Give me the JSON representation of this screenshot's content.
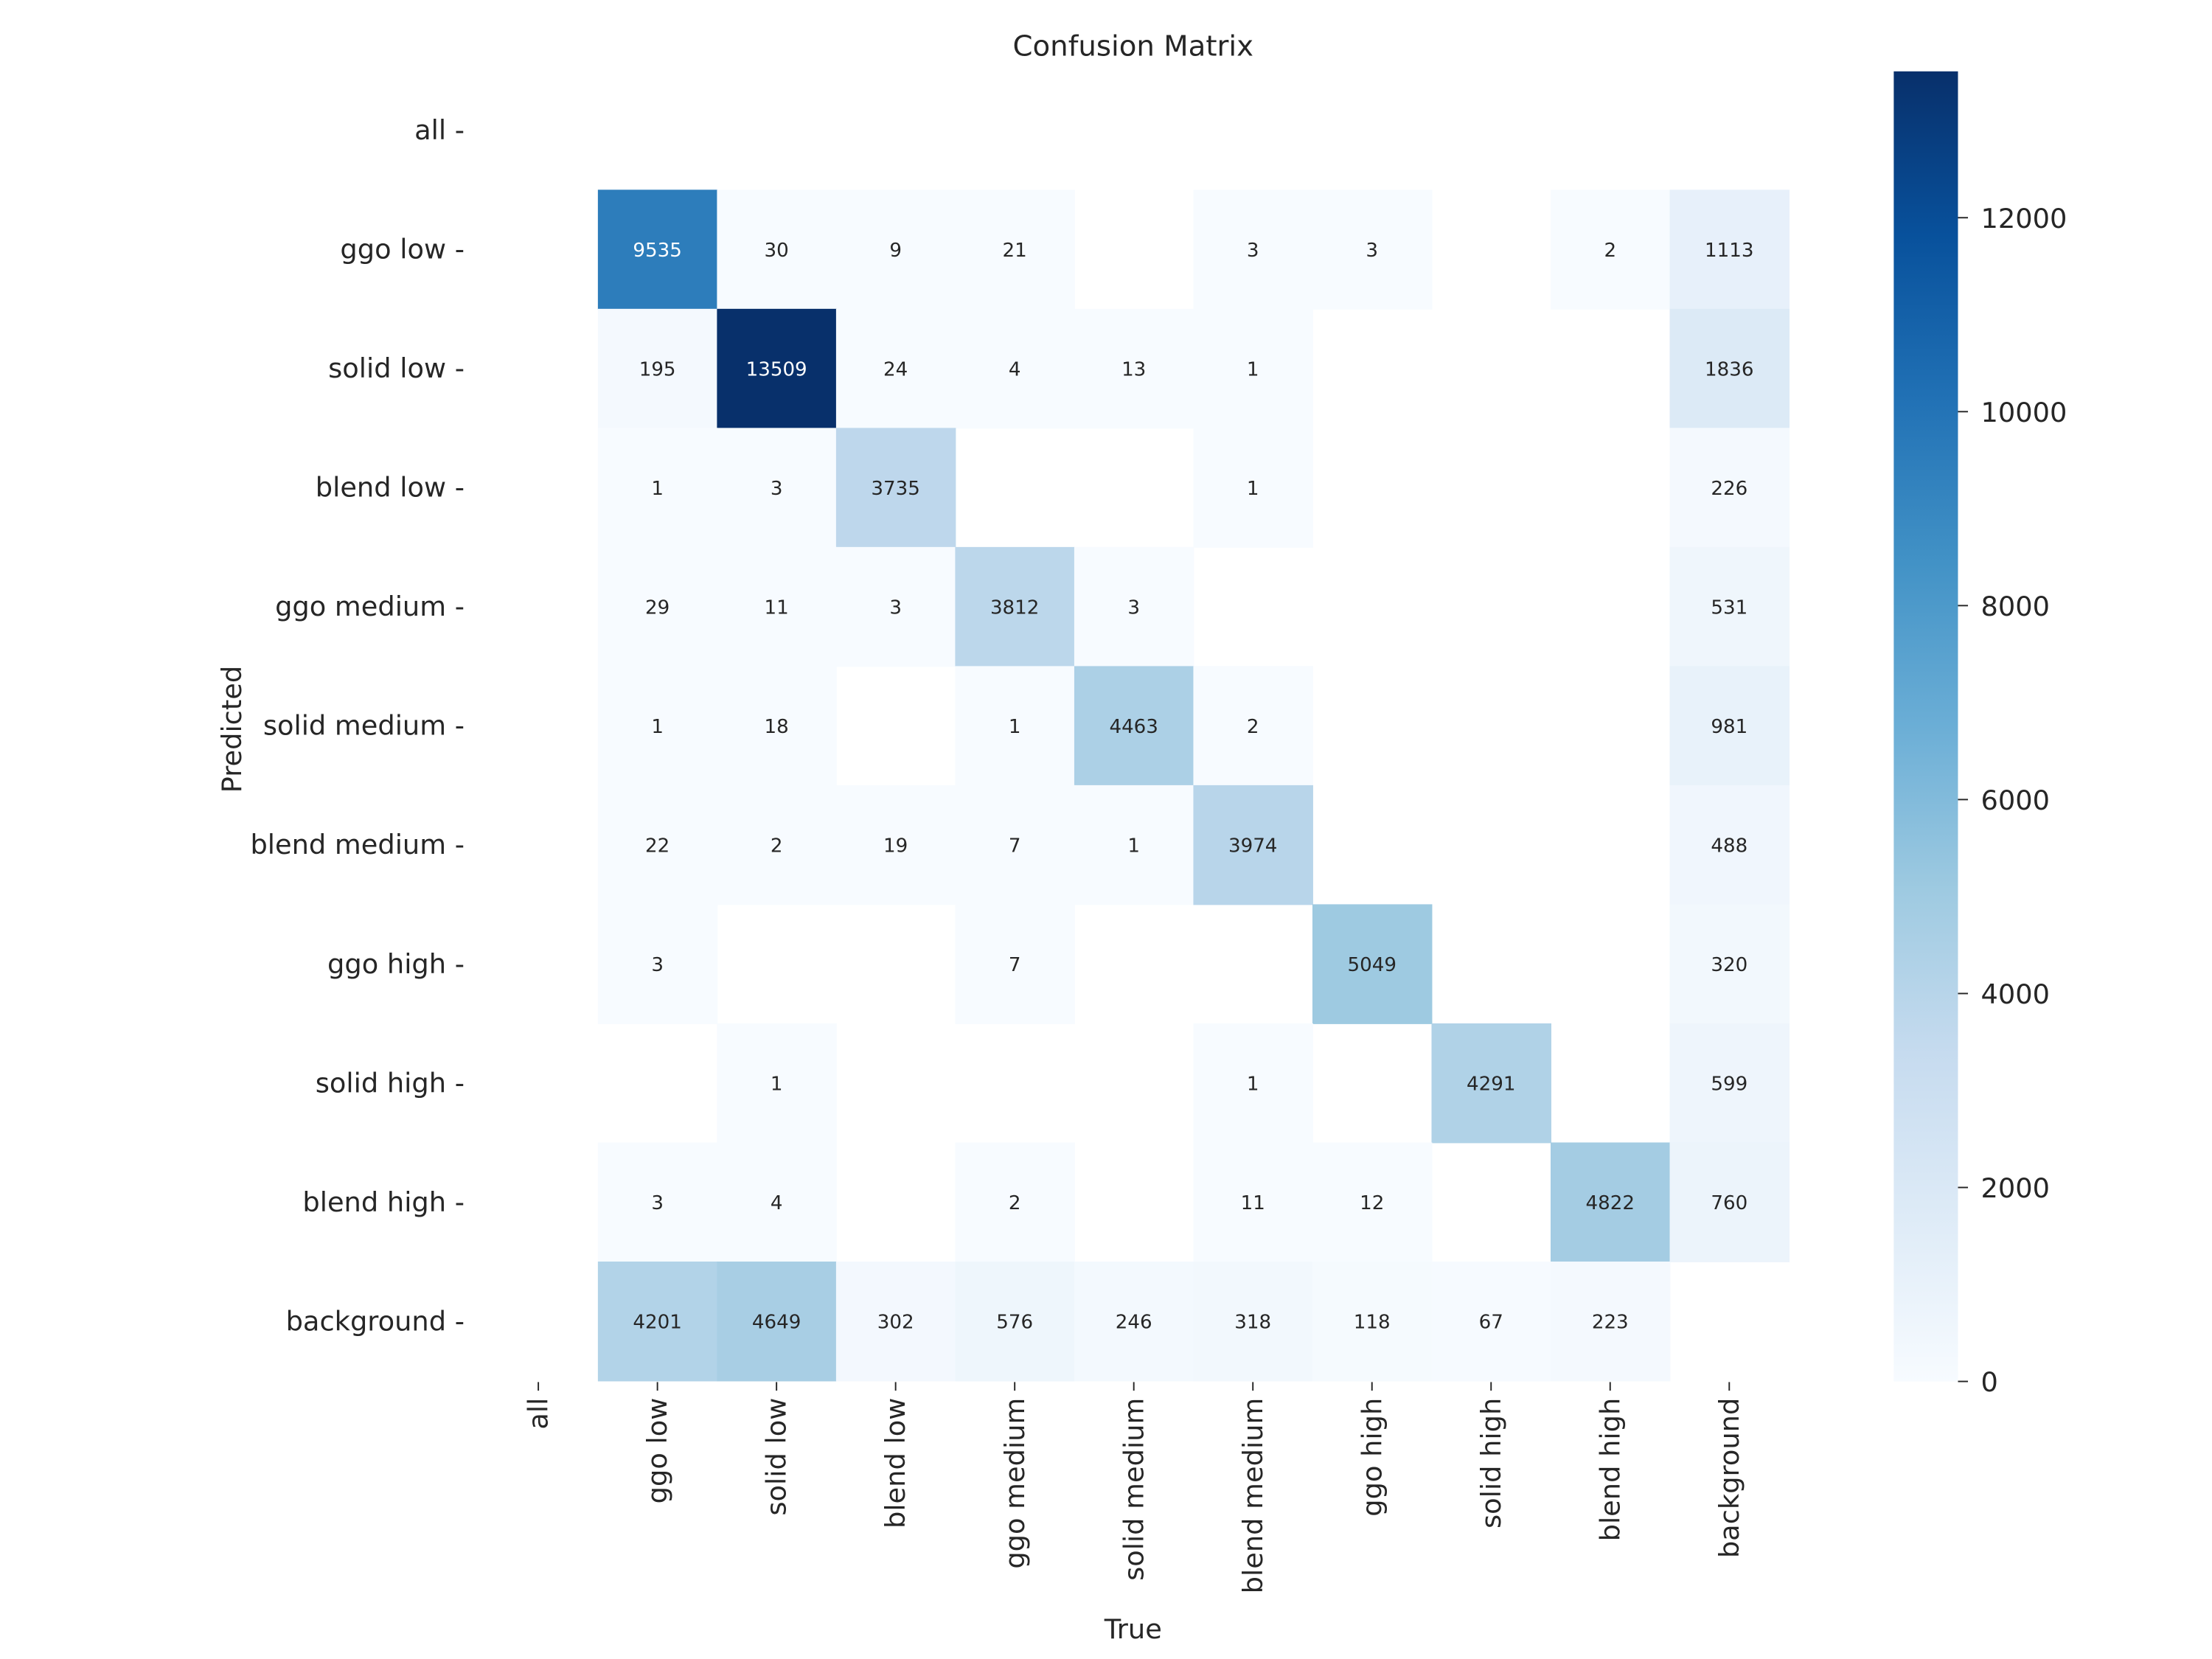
{
  "chart_data": {
    "type": "heatmap",
    "title": "Confusion Matrix",
    "xlabel": "True",
    "ylabel": "Predicted",
    "x_categories": [
      "all",
      "ggo low",
      "solid low",
      "blend low",
      "ggo medium",
      "solid medium",
      "blend medium",
      "ggo high",
      "solid high",
      "blend high",
      "background"
    ],
    "y_categories": [
      "all",
      "ggo low",
      "solid low",
      "blend low",
      "ggo medium",
      "solid medium",
      "blend medium",
      "ggo high",
      "solid high",
      "blend high",
      "background"
    ],
    "values": [
      [
        null,
        null,
        null,
        null,
        null,
        null,
        null,
        null,
        null,
        null,
        null
      ],
      [
        null,
        9535,
        30,
        9,
        21,
        null,
        3,
        3,
        null,
        2,
        1113
      ],
      [
        null,
        195,
        13509,
        24,
        4,
        13,
        1,
        null,
        null,
        null,
        1836
      ],
      [
        null,
        1,
        3,
        3735,
        null,
        null,
        1,
        null,
        null,
        null,
        226
      ],
      [
        null,
        29,
        11,
        3,
        3812,
        3,
        null,
        null,
        null,
        null,
        531
      ],
      [
        null,
        1,
        18,
        null,
        1,
        4463,
        2,
        null,
        null,
        null,
        981
      ],
      [
        null,
        22,
        2,
        19,
        7,
        1,
        3974,
        null,
        null,
        null,
        488
      ],
      [
        null,
        3,
        null,
        null,
        7,
        null,
        null,
        5049,
        null,
        null,
        320
      ],
      [
        null,
        null,
        1,
        null,
        null,
        null,
        1,
        null,
        4291,
        null,
        599
      ],
      [
        null,
        3,
        4,
        null,
        2,
        null,
        11,
        12,
        null,
        4822,
        760
      ],
      [
        null,
        4201,
        4649,
        302,
        576,
        246,
        318,
        118,
        67,
        223,
        null
      ]
    ],
    "colormap": "Blues",
    "vmin": 0,
    "vmax": 13509,
    "colorbar_ticks": [
      0,
      2000,
      4000,
      6000,
      8000,
      10000,
      12000
    ],
    "colorbar_tick_labels": [
      "0",
      "2000",
      "4000",
      "6000",
      "8000",
      "10000",
      "12000"
    ],
    "colorbar_placement": "right",
    "grid": false,
    "annot_light_text_color": "#ffffff",
    "annot_dark_text_color": "#262626"
  }
}
